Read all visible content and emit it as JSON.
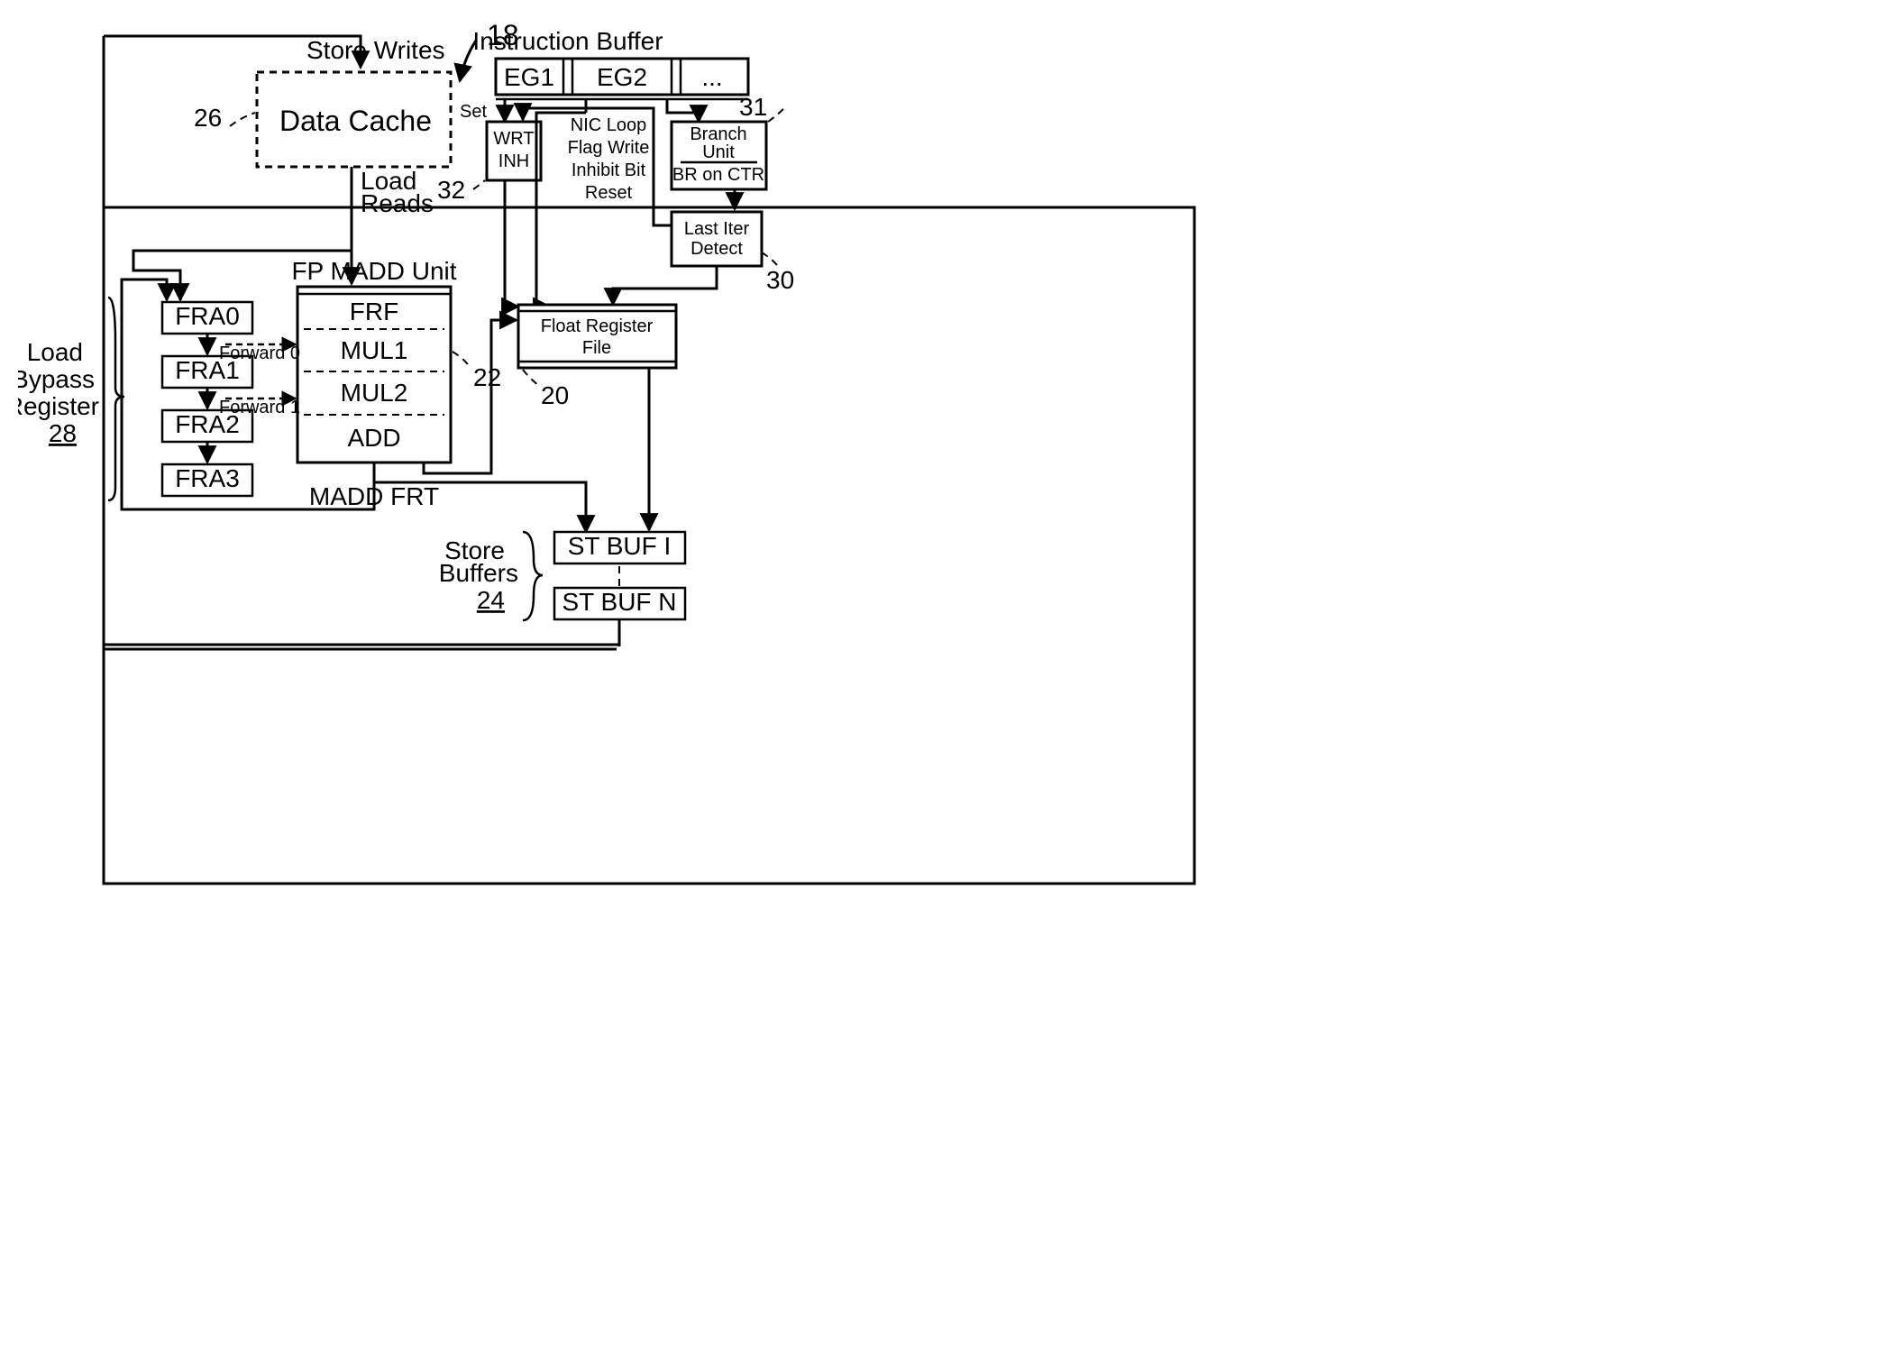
{
  "refs": {
    "r18": "18",
    "r26": "26",
    "r22": "22",
    "r20": "20",
    "r24": "24",
    "r28": "28",
    "r30": "30",
    "r31": "31",
    "r32": "32"
  },
  "blocks": {
    "dataCache": "Data Cache",
    "instrBuffer": "Instruction Buffer",
    "eg1": "EG1",
    "eg2": "EG2",
    "egDots": "...",
    "branchUnit1": "Branch",
    "branchUnit2": "Unit",
    "brOnCtr": "BR on CTR",
    "lastIter1": "Last Iter",
    "lastIter2": "Detect",
    "wrt": "WRT",
    "inh": "INH",
    "nic1": "NIC Loop",
    "nic2": "Flag Write",
    "nic3": "Inhibit Bit",
    "nic4": "Reset",
    "set": "Set",
    "floatReg1": "Float Register",
    "floatReg2": "File",
    "fpMadd": "FP MADD Unit",
    "frf": "FRF",
    "mul1": "MUL1",
    "mul2": "MUL2",
    "add": "ADD",
    "fra0": "FRA0",
    "fra1": "FRA1",
    "fra2": "FRA2",
    "fra3": "FRA3",
    "fwd0": "Forward 0",
    "fwd1": "Forward 1",
    "maddFrt": "MADD FRT",
    "stBufI": "ST BUF I",
    "stBufN": "ST BUF N",
    "storeBuffers": "Store",
    "storeBuffers2": "Buffers",
    "loadBypass1": "Load",
    "loadBypass2": "Bypass",
    "loadBypass3": "Register",
    "storeWrites": "Store Writes",
    "loadReads1": "Load",
    "loadReads2": "Reads"
  }
}
